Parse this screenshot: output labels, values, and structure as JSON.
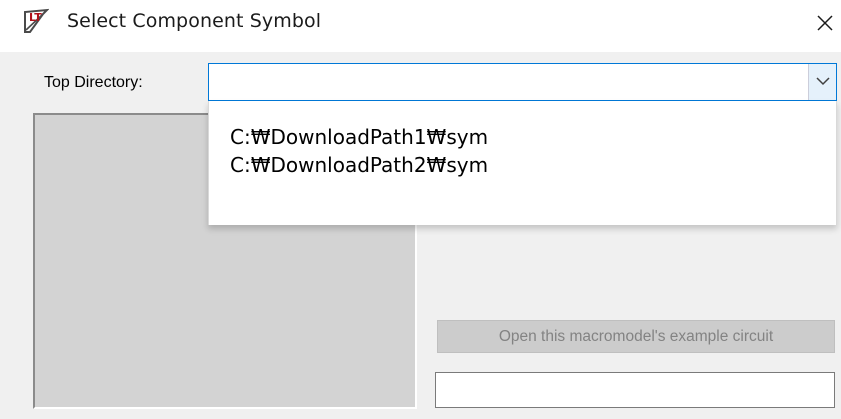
{
  "window": {
    "title": "Select Component Symbol",
    "icon": "ltspice-app-icon",
    "close_icon": "close-icon"
  },
  "directory": {
    "label": "Top Directory:",
    "value": "",
    "dropdown_icon": "chevron-down-icon",
    "options": [
      "C:₩DownloadPath1₩sym",
      "C:₩DownloadPath2₩sym"
    ]
  },
  "main": {
    "example_button_label": "Open this macromodel's example circuit",
    "example_button_enabled": false,
    "description_value": ""
  },
  "colors": {
    "focus_border": "#0078d7",
    "dialog_background": "#f0f0f0",
    "preview_background": "#d3d3d3",
    "disabled_text": "#838383"
  }
}
